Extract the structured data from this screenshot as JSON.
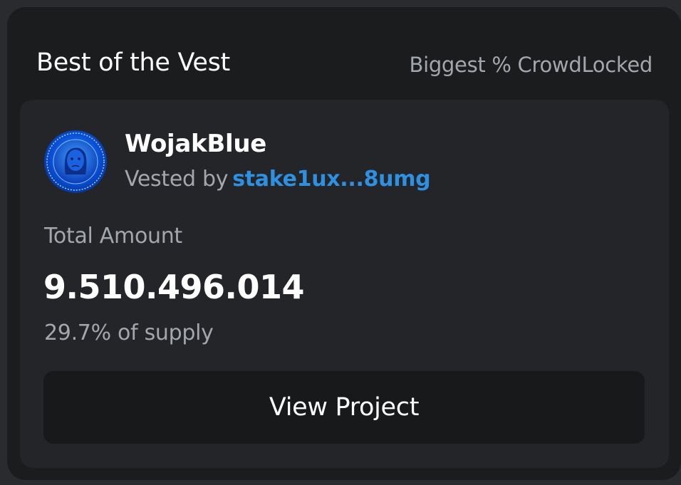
{
  "header": {
    "title": "Best of the Vest",
    "subtitle": "Biggest % CrowdLocked"
  },
  "card": {
    "avatar_icon": "wojakblue-coin-icon",
    "project_name": "WojakBlue",
    "vested_prefix": "Vested by",
    "vested_address": "stake1ux...8umg",
    "total_label": "Total Amount",
    "total_amount": "9.510.496.014",
    "supply_text": "29.7% of supply",
    "button_label": "View Project"
  },
  "colors": {
    "page_bg": "#1b1c1e",
    "card_bg": "#242528",
    "button_bg": "#18191b",
    "accent_link": "#2f8fe0",
    "muted_text": "#a3a6ad"
  }
}
